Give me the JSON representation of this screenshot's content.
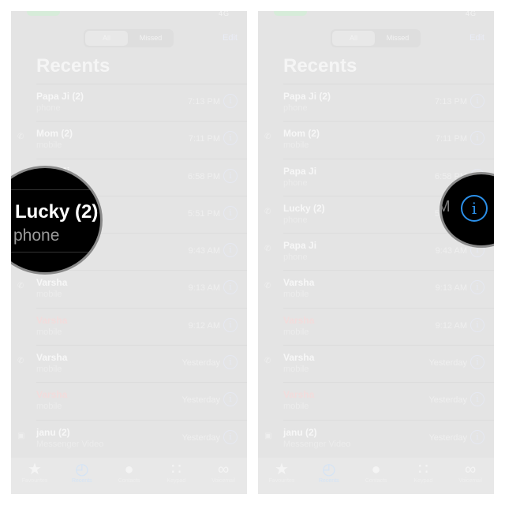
{
  "status_bar": {
    "signal": "4G"
  },
  "segmented": {
    "all": "All",
    "missed": "Missed"
  },
  "edit_label": "Edit",
  "title": "Recents",
  "calls": [
    {
      "name": "Papa Ji (2)",
      "type": "phone",
      "time": "7:13 PM",
      "missed": false,
      "icon": ""
    },
    {
      "name": "Mom (2)",
      "type": "mobile",
      "time": "7:11 PM",
      "missed": false,
      "icon": "phone-outgoing"
    },
    {
      "name": "Papa Ji",
      "type": "phone",
      "time": "6:58 PM",
      "missed": false,
      "icon": ""
    },
    {
      "name": "Lucky (2)",
      "type": "phone",
      "time": "5:51 PM",
      "missed": false,
      "icon": "phone-outgoing"
    },
    {
      "name": "Papa Ji",
      "type": "phone",
      "time": "9:43 AM",
      "missed": false,
      "icon": "phone-outgoing"
    },
    {
      "name": "Varsha",
      "type": "mobile",
      "time": "9:13 AM",
      "missed": false,
      "icon": "phone-outgoing"
    },
    {
      "name": "Varsha",
      "type": "mobile",
      "time": "9:12 AM",
      "missed": true,
      "icon": ""
    },
    {
      "name": "Varsha",
      "type": "mobile",
      "time": "Yesterday",
      "missed": false,
      "icon": "phone-outgoing"
    },
    {
      "name": "Varsha",
      "type": "mobile",
      "time": "Yesterday",
      "missed": true,
      "icon": ""
    },
    {
      "name": "janu (2)",
      "type": "Messenger Video",
      "time": "Yesterday",
      "missed": false,
      "icon": "video"
    }
  ],
  "tabs": [
    {
      "label": "Favourites",
      "icon": "star"
    },
    {
      "label": "Recents",
      "icon": "clock",
      "active": true
    },
    {
      "label": "Contacts",
      "icon": "person"
    },
    {
      "label": "Keypad",
      "icon": "keypad"
    },
    {
      "label": "Voicemail",
      "icon": "voicemail"
    }
  ],
  "magnifier_left": {
    "name": "Lucky (2)",
    "sub": "phone"
  },
  "magnifier_right": {
    "partial_time": "M",
    "icon": "info"
  },
  "info_glyph": "i",
  "colors": {
    "accent": "#2b8fe8",
    "missed": "#f2dcdc",
    "background": "#e4e4e4"
  }
}
